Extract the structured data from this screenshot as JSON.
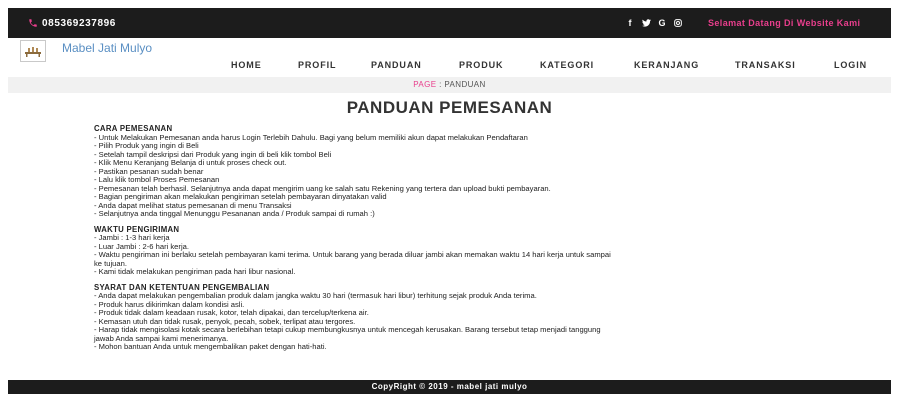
{
  "topbar": {
    "phone": "085369237896",
    "social": [
      "f",
      "❦",
      "G",
      "◎"
    ],
    "welcome": "Selamat Datang Di Website Kami"
  },
  "brand": {
    "name": "Mabel Jati Mulyo"
  },
  "nav": {
    "items": [
      "HOME",
      "PROFIL",
      "PANDUAN",
      "PRODUK",
      "KATEGORI",
      "KERANJANG",
      "TRANSAKSI",
      "LOGIN"
    ]
  },
  "breadcrumb": {
    "page": "PAGE",
    "separator": ":",
    "current": "PANDUAN"
  },
  "page": {
    "title": "PANDUAN PEMESANAN"
  },
  "sections": [
    {
      "heading": "CARA PEMESANAN",
      "lines": [
        "- Untuk Melakukan Pemesanan anda harus Login Terlebih Dahulu. Bagi yang belum memiliki akun dapat melakukan Pendaftaran",
        "- Pilih Produk yang ingin di Beli",
        "- Setelah tampil deskripsi dari Produk yang ingin di beli klik tombol Beli",
        "- Klik Menu Keranjang Belanja di untuk proses check out.",
        "- Pastikan pesanan sudah benar",
        "- Lalu klik tombol Proses Pemesanan",
        "- Pemesanan telah berhasil. Selanjutnya anda dapat mengirim uang ke salah satu Rekening yang tertera dan upload bukti pembayaran.",
        "- Bagian pengiriman akan melakukan pengiriman setelah pembayaran dinyatakan valid",
        "- Anda dapat melihat status pemesanan di menu Transaksi",
        "- Selanjutnya anda tinggal Menunggu Pesananan anda / Produk sampai di rumah :)"
      ]
    },
    {
      "heading": "WAKTU PENGIRIMAN",
      "lines": [
        "- Jambi : 1-3 hari kerja",
        "- Luar Jambi : 2-6 hari kerja.",
        "- Waktu pengiriman ini berlaku setelah pembayaran kami terima. Untuk barang yang berada diluar jambi akan memakan waktu 14 hari kerja untuk sampai",
        "ke tujuan.",
        "- Kami tidak melakukan pengiriman pada hari libur nasional."
      ]
    },
    {
      "heading": "SYARAT DAN KETENTUAN PENGEMBALIAN",
      "lines": [
        "- Anda dapat melakukan pengembalian produk dalam jangka waktu 30 hari (termasuk hari libur) terhitung sejak produk Anda terima.",
        "- Produk harus dikirimkan dalam kondisi asli.",
        "- Produk tidak dalam keadaan rusak, kotor, telah dipakai, dan tercelup/terkena air.",
        "- Kemasan utuh dan tidak rusak, penyok, pecah, sobek, terlipat atau tergores.",
        "- Harap tidak mengisolasi kotak secara berlebihan tetapi cukup membungkusnya untuk mencegah kerusakan. Barang tersebut tetap menjadi tanggung",
        "jawab Anda sampai kami menerimanya.",
        "- Mohon bantuan Anda untuk mengembalikan paket dengan hati-hati."
      ]
    }
  ],
  "footer": {
    "text": "CopyRight © 2019 - mabel jati mulyo"
  },
  "colors": {
    "accent": "#e83e8c",
    "brand": "#5a8fc3",
    "dark": "#1c1c1c"
  }
}
